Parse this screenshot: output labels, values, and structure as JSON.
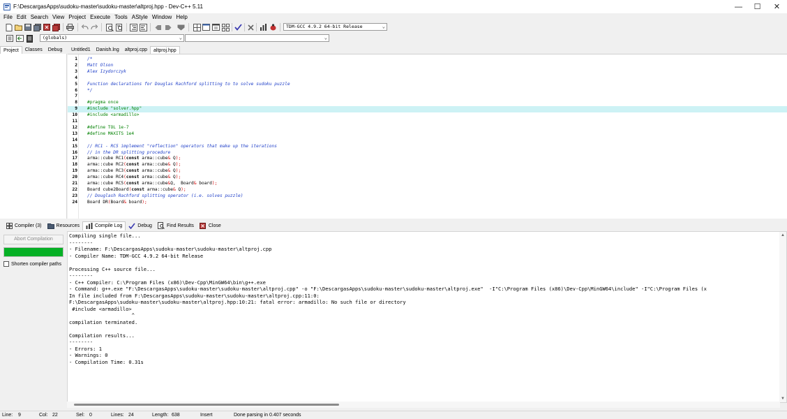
{
  "window": {
    "title": "F:\\DescargasApps\\sudoku-master\\sudoku-master\\altproj.hpp - Dev-C++ 5.11",
    "minimize_glyph": "—",
    "maximize_glyph": "☐",
    "close_glyph": "✕"
  },
  "menu": [
    "File",
    "Edit",
    "Search",
    "View",
    "Project",
    "Execute",
    "Tools",
    "AStyle",
    "Window",
    "Help"
  ],
  "toolbar": {
    "compiler_select": "TDM-GCC 4.9.2 64-bit Release",
    "scope_select": "(globals)",
    "member_select": ""
  },
  "left_tabs": [
    "Project",
    "Classes",
    "Debug"
  ],
  "editor_tabs": [
    "Untitled1",
    "Danish.lng",
    "altproj.cpp",
    "altproj.hpp"
  ],
  "editor": {
    "highlighted_line": 9,
    "lines": [
      {
        "n": "1",
        "t": "/*"
      },
      {
        "n": "2",
        "t": "Matt Olson"
      },
      {
        "n": "3",
        "t": "Alex Izydorczyk"
      },
      {
        "n": "4",
        "t": ""
      },
      {
        "n": "5",
        "t": "Function declarations for Douglas Rachford splitting to to solve sudoku puzzle"
      },
      {
        "n": "6",
        "t": "*/"
      },
      {
        "n": "7",
        "t": ""
      },
      {
        "n": "8",
        "t": "#pragma once"
      },
      {
        "n": "9",
        "t": "#include \"solver.hpp\""
      },
      {
        "n": "10",
        "t": "#include <armadillo>"
      },
      {
        "n": "11",
        "t": ""
      },
      {
        "n": "12",
        "t": "#define TOL 1e-7"
      },
      {
        "n": "13",
        "t": "#define MAXITS 1e4"
      },
      {
        "n": "14",
        "t": ""
      },
      {
        "n": "15",
        "t": "// RC1 - RC5 implement \"reflection\" operators that make up the iterations"
      },
      {
        "n": "16",
        "t": "// in the DR splitting procedure"
      },
      {
        "n": "17",
        "t": "arma::cube RC1(const arma::cube& Q);"
      },
      {
        "n": "18",
        "t": "arma::cube RC2(const arma::cube& Q);"
      },
      {
        "n": "19",
        "t": "arma::cube RC3(const arma::cube& Q);"
      },
      {
        "n": "20",
        "t": "arma::cube RC4(const arma::cube& Q);"
      },
      {
        "n": "21",
        "t": "arma::cube RC5(const arma::cube&Q,  Board& board);"
      },
      {
        "n": "22",
        "t": "Board cube2Board(const arma::cube& Q);"
      },
      {
        "n": "23",
        "t": "// Douglash Rachford splitting operator (i.e. solves puzzle)"
      },
      {
        "n": "24",
        "t": "Board DR(Board& board);"
      }
    ]
  },
  "bottom_tabs": [
    {
      "label": "Compiler (3)",
      "icon": "compiler-grid-icon"
    },
    {
      "label": "Resources",
      "icon": "resources-icon"
    },
    {
      "label": "Compile Log",
      "icon": "compile-log-chart-icon"
    },
    {
      "label": "Debug",
      "icon": "debug-check-icon"
    },
    {
      "label": "Find Results",
      "icon": "find-results-icon"
    },
    {
      "label": "Close",
      "icon": "close-panel-icon"
    }
  ],
  "active_bottom_tab": "Compile Log",
  "compile_panel": {
    "abort_label": "Abort Compilation",
    "progress": 1.0,
    "shorten_paths_label": "Shorten compiler paths",
    "shorten_paths_checked": false
  },
  "compile_log": [
    "Compiling single file...",
    "--------",
    "- Filename: F:\\DescargasApps\\sudoku-master\\sudoku-master\\altproj.cpp",
    "- Compiler Name: TDM-GCC 4.9.2 64-bit Release",
    "",
    "Processing C++ source file...",
    "--------",
    "- C++ Compiler: C:\\Program Files (x86)\\Dev-Cpp\\MinGW64\\bin\\g++.exe",
    "- Command: g++.exe \"F:\\DescargasApps\\sudoku-master\\sudoku-master\\altproj.cpp\" -o \"F:\\DescargasApps\\sudoku-master\\sudoku-master\\altproj.exe\"  -I\"C:\\Program Files (x86)\\Dev-Cpp\\MinGW64\\include\" -I\"C:\\Program Files (x",
    "In file included from F:\\DescargasApps\\sudoku-master\\sudoku-master\\altproj.cpp:11:0:",
    "F:\\DescargasApps\\sudoku-master\\sudoku-master\\altproj.hpp:10:21: fatal error: armadillo: No such file or directory",
    " #include <armadillo>",
    "                     ^",
    "compilation terminated.",
    "",
    "Compilation results...",
    "--------",
    "- Errors: 1",
    "- Warnings: 0",
    "- Compilation Time: 0.31s"
  ],
  "status": {
    "line_label": "Line:",
    "line": "9",
    "col_label": "Col:",
    "col": "22",
    "sel_label": "Sel:",
    "sel": "0",
    "lines_label": "Lines:",
    "lines": "24",
    "length_label": "Length:",
    "length": "638",
    "mode": "Insert",
    "message": "Done parsing in 0.407 seconds"
  }
}
